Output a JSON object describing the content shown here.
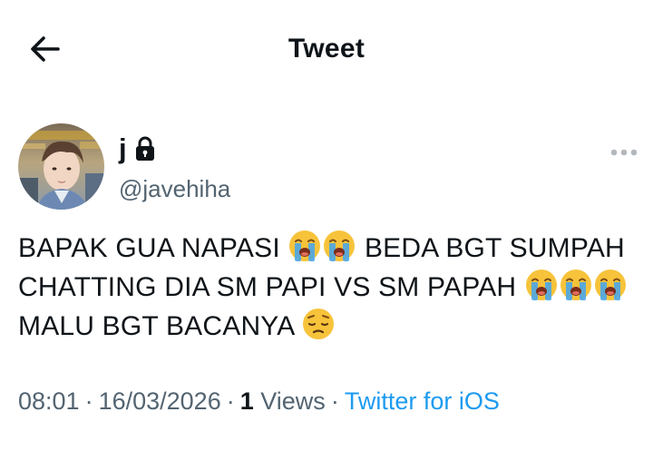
{
  "header": {
    "title": "Tweet",
    "back_icon": "arrow-left-icon"
  },
  "author": {
    "display_name": "j",
    "handle": "@javehiha",
    "protected": true,
    "avatar": "profile-photo"
  },
  "tweet": {
    "text_segments": [
      "BAPAK GUA NAPASI ",
      " BEDA BGT SUMPAH CHATTING DIA SM PAPI VS SM PAPAH ",
      " MALU BGT BACANYA "
    ],
    "emojis": [
      "loudly-crying-face",
      "pensive-face"
    ]
  },
  "meta": {
    "time": "08:01",
    "date": "16/03/2026",
    "views_count": "1",
    "views_label": "Views",
    "source": "Twitter for iOS",
    "separator": "·"
  },
  "colors": {
    "text": "#0f1419",
    "secondary": "#536471",
    "link": "#1d9bf0"
  }
}
